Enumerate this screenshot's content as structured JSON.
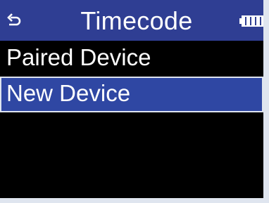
{
  "header": {
    "title": "Timecode",
    "back_icon": "back-arrow-icon",
    "battery_icon": "battery-full-icon"
  },
  "menu": {
    "items": [
      {
        "label": "Paired Device",
        "selected": false
      },
      {
        "label": "New Device",
        "selected": true
      }
    ]
  },
  "colors": {
    "header_background": "#2f3e93",
    "selected_background": "#2f47a3",
    "screen_background": "#000000",
    "bezel": "#dfe5ef",
    "text": "#ffffff"
  }
}
